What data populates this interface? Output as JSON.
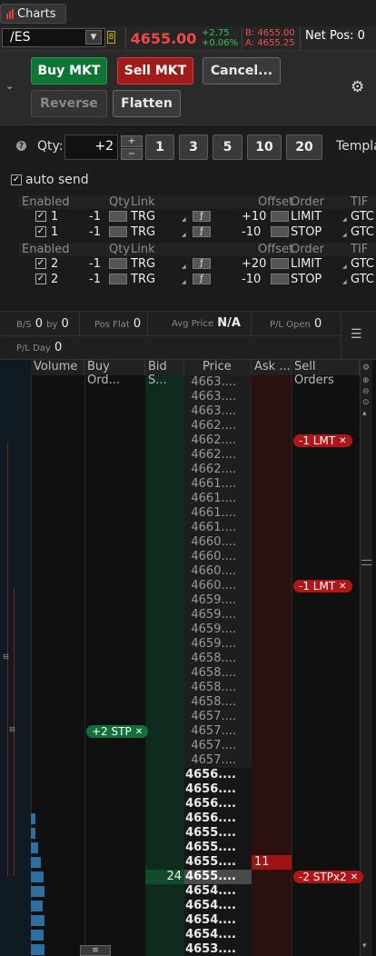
{
  "app": {
    "tab_label": "Charts"
  },
  "symbol_bar": {
    "symbol": "/ES",
    "link_group": "8",
    "last_price": "4655.00",
    "change": "+2.75",
    "change_pct": "+0.06%",
    "bid": "B: 4655.00",
    "ask": "A: 4655.25",
    "net_pos": "Net Pos: 0"
  },
  "order_buttons": {
    "buy_mkt": "Buy MKT",
    "sell_mkt": "Sell MKT",
    "cancel": "Cancel...",
    "reverse": "Reverse",
    "flatten": "Flatten"
  },
  "qty": {
    "label": "Qty:",
    "value": "+2",
    "presets": [
      "1",
      "3",
      "5",
      "10",
      "20"
    ],
    "template_label": "Templa"
  },
  "auto_send": {
    "label": "auto send",
    "checked": true
  },
  "bracket": {
    "headers": {
      "enabled": "Enabled",
      "qty": "Qty",
      "link": "Link",
      "offset": "Offset",
      "order": "Order",
      "tif": "TIF"
    },
    "groups": [
      {
        "rows": [
          {
            "enabled": "1",
            "qty": "-1",
            "link": "TRG",
            "offset": "+10",
            "order": "LIMIT",
            "tif": "GTC"
          },
          {
            "enabled": "1",
            "qty": "-1",
            "link": "TRG",
            "offset": "-10",
            "order": "STOP",
            "tif": "GTC"
          }
        ]
      },
      {
        "rows": [
          {
            "enabled": "2",
            "qty": "-1",
            "link": "TRG",
            "offset": "+20",
            "order": "LIMIT",
            "tif": "GTC"
          },
          {
            "enabled": "2",
            "qty": "-1",
            "link": "TRG",
            "offset": "-10",
            "order": "STOP",
            "tif": "GTC"
          }
        ]
      }
    ]
  },
  "status": {
    "bs_label": "B/S",
    "bs_buy": "0",
    "bs_by": "by",
    "bs_sell": "0",
    "pos_flat_label": "Pos Flat",
    "pos_flat": "0",
    "avg_price_label": "Avg Price",
    "avg_price": "N/A",
    "pl_open_label": "P/L Open",
    "pl_open": "0",
    "pl_day_label": "P/L Day",
    "pl_day": "0"
  },
  "ladder": {
    "headers": {
      "volume": "Volume",
      "buy_orders": "Buy Ord...",
      "bid_size": "Bid S...",
      "price": "Price",
      "ask_size": "Ask ...",
      "sell_orders": "Sell Orders"
    },
    "prices": [
      "4663....",
      "4663....",
      "4663....",
      "4662....",
      "4662....",
      "4662....",
      "4662....",
      "4661....",
      "4661....",
      "4661....",
      "4661....",
      "4660....",
      "4660....",
      "4660....",
      "4660....",
      "4659....",
      "4659....",
      "4659....",
      "4659....",
      "4658....",
      "4658....",
      "4658....",
      "4658....",
      "4657....",
      "4657....",
      "4657....",
      "4657....",
      "4656....",
      "4656....",
      "4656....",
      "4656....",
      "4655....",
      "4655....",
      "4655....",
      "4655....",
      "4654....",
      "4654....",
      "4654....",
      "4654....",
      "4653...."
    ],
    "current_index": 34,
    "bid_size": {
      "index": 34,
      "value": "24"
    },
    "ask_size": {
      "index": 33,
      "value": "11"
    },
    "sell_orders": [
      {
        "index": 4,
        "label": "-1 LMT"
      },
      {
        "index": 14,
        "label": "-1 LMT"
      },
      {
        "index": 34,
        "label": "-2 STPx2"
      }
    ],
    "buy_orders": [
      {
        "index": 24,
        "label": "+2 STP"
      }
    ],
    "volume_profile": [
      {
        "index": 30,
        "fraction": 0.1
      },
      {
        "index": 31,
        "fraction": 0.1
      },
      {
        "index": 32,
        "fraction": 0.15
      },
      {
        "index": 33,
        "fraction": 0.22
      },
      {
        "index": 34,
        "fraction": 0.28
      },
      {
        "index": 35,
        "fraction": 0.3
      },
      {
        "index": 36,
        "fraction": 0.26
      },
      {
        "index": 37,
        "fraction": 0.3
      },
      {
        "index": 38,
        "fraction": 0.28
      },
      {
        "index": 39,
        "fraction": 0.3
      }
    ]
  },
  "colors": {
    "buy": "#0f7534",
    "sell": "#a11b1b",
    "price_down": "#f04848",
    "change_up": "#36c84a",
    "bid_column": "#0e2b1d",
    "ask_column": "#2b1010",
    "sell_badge": "#b01616",
    "buy_badge": "#10713a",
    "volume_bar": "#2c6fa0"
  },
  "icons": {
    "settings": "gear-icon",
    "collapse": "chevron-down-icon",
    "menu": "list-icon",
    "help": "help-icon"
  }
}
